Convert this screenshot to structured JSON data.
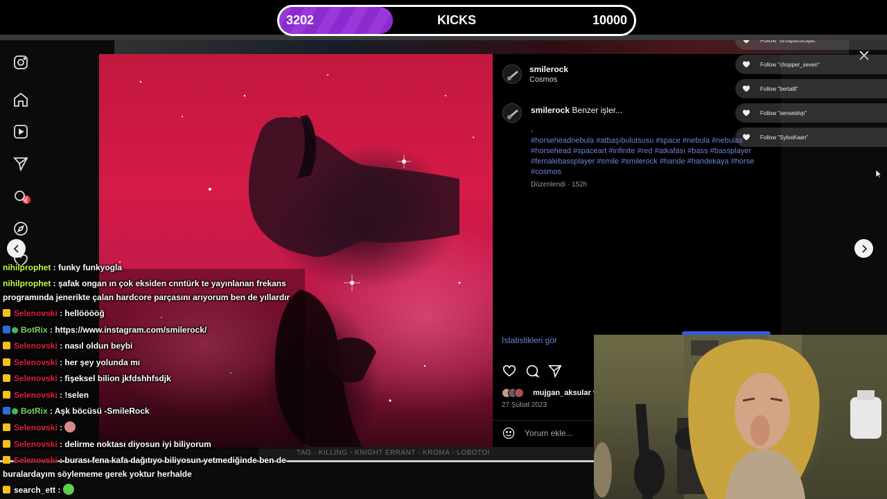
{
  "kicks": {
    "current": "3202",
    "label": "KICKS",
    "goal": "10000",
    "progress": 0.3202,
    "fill_color": "#8a2bd0"
  },
  "nav": {
    "icons": [
      "instagram-logo-icon",
      "home-icon",
      "reels-icon",
      "direct-icon",
      "search-icon",
      "explore-icon",
      "heart-icon"
    ],
    "badge_count": "4"
  },
  "post": {
    "author": "smilerock",
    "location": "Cosmos",
    "caption_user": "smilerock",
    "caption_text": "Benzer işler...",
    "caption_dot": ".",
    "hashtags": "#horseheadnebula #atbaşıbulutsusu #space #nebula #nebulas #horsehead #spaceart #infinite #red #atkafası #bass #bassplayer #femalebassplayer #smile #smilerock #hande #handekaya #horse #cosmos",
    "edited": "Düzenlendi · 152h",
    "stats_link": "İstatistikleri gör",
    "liked_by": "mujgan_aksular v",
    "date": "27 Şubat 2023",
    "comment_placeholder": "Yorum ekle..."
  },
  "follow_alerts": [
    "Follow \"orospucocupic\"",
    "Follow \"chopper_seven\"",
    "Follow \"bertalll\"",
    "Follow \"senseidvp\"",
    "Follow \"SyloxKaan\""
  ],
  "chat": {
    "messages": [
      {
        "user": "nihilprophet",
        "color": "yellow",
        "badges": [],
        "text": "funky funkyogla"
      },
      {
        "user": "nihilprophet",
        "color": "yellow",
        "badges": [],
        "text": "şafak ongan ın çok eksiden cnntürk te yayınlanan frekans"
      },
      {
        "user": "",
        "color": "",
        "badges": [],
        "text": "programında jenerikte çalan hardcore parçasını arıyorum ben de yıllardır"
      },
      {
        "user": "Selenovski",
        "color": "red",
        "badges": [
          "crown"
        ],
        "text": "hellööööğ"
      },
      {
        "user": "BotRix",
        "color": "green",
        "badges": [
          "bot",
          "verified"
        ],
        "text": "https://www.instagram.com/smilerock/"
      },
      {
        "user": "Selenovski",
        "color": "red",
        "badges": [
          "crown"
        ],
        "text": "nasıl oldun beybi"
      },
      {
        "user": "Selenovski",
        "color": "red",
        "badges": [
          "crown"
        ],
        "text": "her şey yolunda mı"
      },
      {
        "user": "Selenovski",
        "color": "red",
        "badges": [
          "crown"
        ],
        "text": "fişeksel bilion jkfdshhfsdjk"
      },
      {
        "user": "Selenovski",
        "color": "red",
        "badges": [
          "crown"
        ],
        "text": "!selen"
      },
      {
        "user": "BotRix",
        "color": "green",
        "badges": [
          "bot",
          "verified"
        ],
        "text": "Aşk böcüsü -SmileRock"
      },
      {
        "user": "Selenovski",
        "color": "red",
        "badges": [
          "crown"
        ],
        "text": "",
        "emote": "emote-icon"
      },
      {
        "user": "Selenovski",
        "color": "red",
        "badges": [
          "crown"
        ],
        "text": "delirme noktası diyosun iyi biliyorum"
      },
      {
        "user": "Selenovski",
        "color": "red",
        "badges": [
          "crown"
        ],
        "text": "burası fena kafa dağıtıyo biliyosun yetmediğinde ben de"
      },
      {
        "user": "",
        "color": "",
        "badges": [],
        "text": "buralardayım söylememe gerek yoktur herhalde"
      },
      {
        "user": "search_ett",
        "color": "plain",
        "badges": [
          "crown"
        ],
        "text": "",
        "emote": "emote-icon"
      }
    ]
  },
  "banner_text": "TAG - KILLING - KNIGHT ERRANT - KROMA - LOBOTOI",
  "colors": {
    "accent_link": "#6b84d6",
    "chat_red": "#e01e3c",
    "chat_green": "#7dd35a",
    "kicks_purple": "#8a2bd0"
  }
}
